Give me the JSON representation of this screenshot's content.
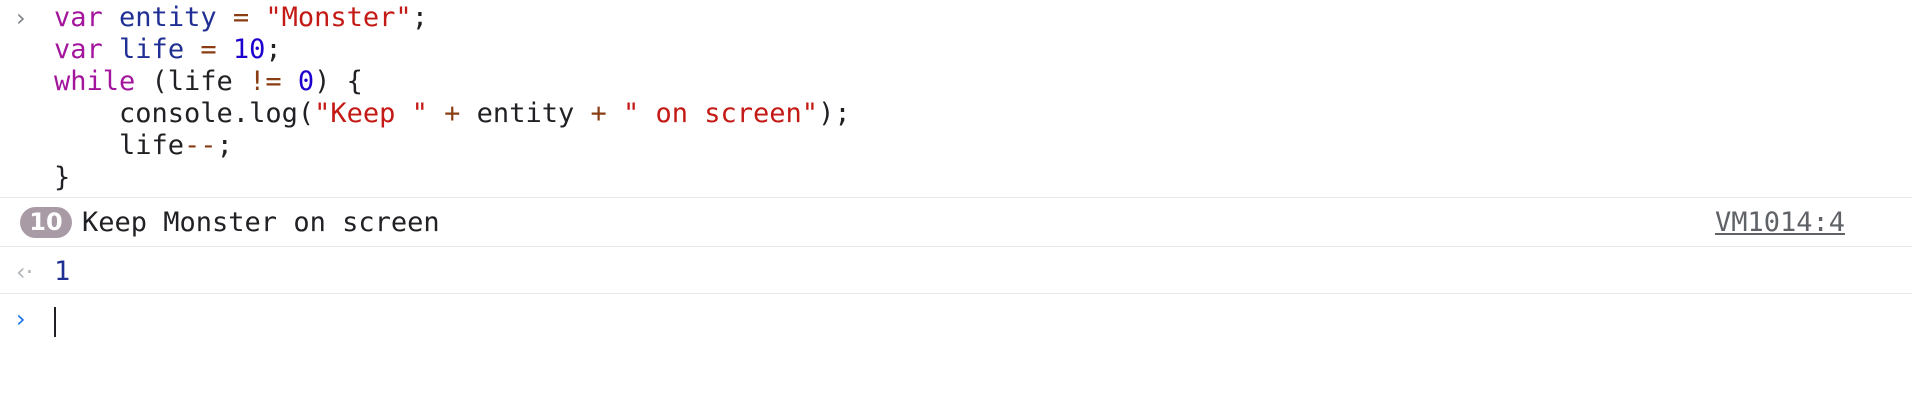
{
  "console": {
    "input_entry": {
      "prompt_glyph": "›",
      "lines": [
        [
          {
            "text": "var",
            "kind": "kw"
          },
          {
            "text": " ",
            "kind": "plain"
          },
          {
            "text": "entity",
            "kind": "ident"
          },
          {
            "text": " ",
            "kind": "plain"
          },
          {
            "text": "=",
            "kind": "op"
          },
          {
            "text": " ",
            "kind": "plain"
          },
          {
            "text": "\"Monster\"",
            "kind": "str"
          },
          {
            "text": ";",
            "kind": "plain"
          }
        ],
        [
          {
            "text": "var",
            "kind": "kw"
          },
          {
            "text": " ",
            "kind": "plain"
          },
          {
            "text": "life",
            "kind": "ident"
          },
          {
            "text": " ",
            "kind": "plain"
          },
          {
            "text": "=",
            "kind": "op"
          },
          {
            "text": " ",
            "kind": "plain"
          },
          {
            "text": "10",
            "kind": "num"
          },
          {
            "text": ";",
            "kind": "plain"
          }
        ],
        [
          {
            "text": "while",
            "kind": "kw"
          },
          {
            "text": " (life ",
            "kind": "plain"
          },
          {
            "text": "!=",
            "kind": "op"
          },
          {
            "text": " ",
            "kind": "plain"
          },
          {
            "text": "0",
            "kind": "num"
          },
          {
            "text": ") {",
            "kind": "plain"
          }
        ],
        [
          {
            "text": "    console.log(",
            "kind": "plain"
          },
          {
            "text": "\"Keep \"",
            "kind": "str"
          },
          {
            "text": " ",
            "kind": "plain"
          },
          {
            "text": "+",
            "kind": "op"
          },
          {
            "text": " entity ",
            "kind": "plain"
          },
          {
            "text": "+",
            "kind": "op"
          },
          {
            "text": " ",
            "kind": "plain"
          },
          {
            "text": "\" on screen\"",
            "kind": "str"
          },
          {
            "text": ");",
            "kind": "plain"
          }
        ],
        [
          {
            "text": "    life",
            "kind": "plain"
          },
          {
            "text": "--",
            "kind": "op"
          },
          {
            "text": ";",
            "kind": "plain"
          }
        ],
        [
          {
            "text": "}",
            "kind": "plain"
          }
        ]
      ]
    },
    "log_entry": {
      "repeat_count": "10",
      "message": "Keep Monster on screen",
      "source": "VM1014:4"
    },
    "result_entry": {
      "icon_glyph": "‹·",
      "value": "1"
    },
    "prompt": {
      "glyph": "›",
      "value": ""
    }
  },
  "colors": {
    "keyword": "#a3159c",
    "identifier": "#1f2f93",
    "string": "#c41a16",
    "number": "#1c00cf",
    "operator": "#8a3d12",
    "badge_bg": "#a89ba6",
    "prompt_accent": "#1a73e8"
  },
  "icons": {
    "input_prompt": "chevron-right-icon",
    "result": "return-value-icon",
    "active_prompt": "chevron-right-icon"
  }
}
